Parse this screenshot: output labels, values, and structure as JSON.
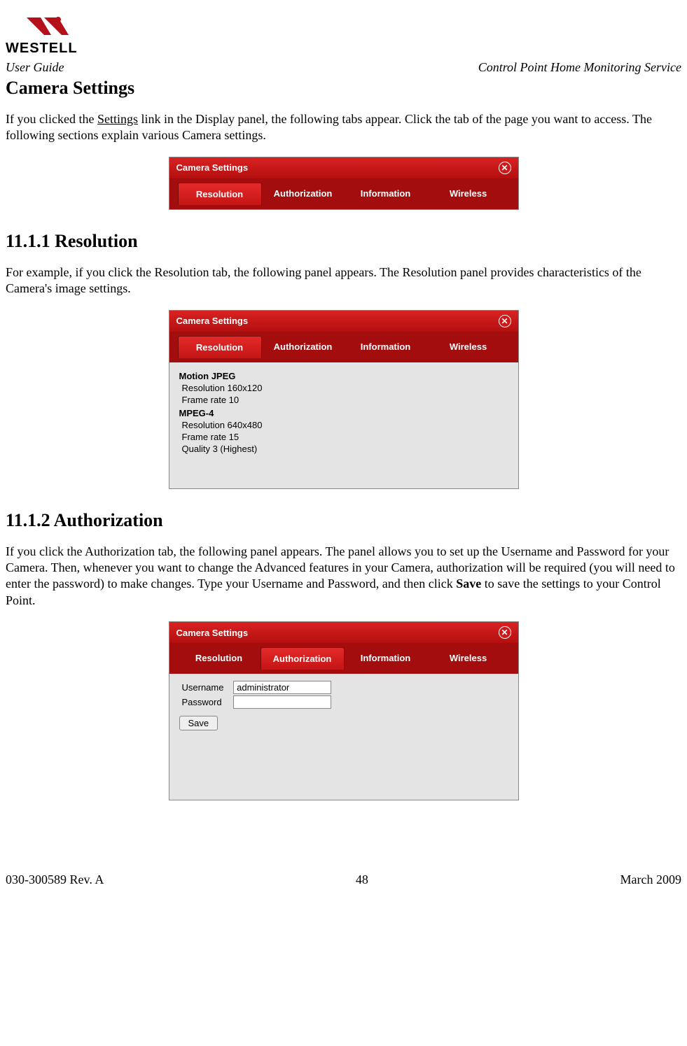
{
  "header": {
    "left": "User Guide",
    "right": "Control Point Home Monitoring Service"
  },
  "brand": "WESTELL",
  "section_title": "Camera Settings",
  "intro_before_link": "If you clicked the ",
  "intro_link": "Settings",
  "intro_after_link": " link in the Display panel, the following tabs appear. Click the tab of the page you want to access. The following sections explain various Camera settings.",
  "panel1": {
    "title": "Camera Settings",
    "tabs": [
      "Resolution",
      "Authorization",
      "Information",
      "Wireless"
    ],
    "active_tab": 0
  },
  "sub1": {
    "heading": "11.1.1 Resolution",
    "text": "For example, if you click the Resolution tab, the following panel appears. The Resolution panel provides characteristics of the Camera's image settings."
  },
  "panel2": {
    "title": "Camera Settings",
    "tabs": [
      "Resolution",
      "Authorization",
      "Information",
      "Wireless"
    ],
    "active_tab": 0,
    "body": {
      "group1_title": "Motion JPEG",
      "g1_row1": "Resolution  160x120",
      "g1_row2": "Frame rate 10",
      "group2_title": "MPEG-4",
      "g2_row1": "Resolution  640x480",
      "g2_row2": "Frame rate 15",
      "g2_row3": "Quality        3 (Highest)"
    }
  },
  "sub2": {
    "heading": "11.1.2 Authorization",
    "text_before_bold": "If you click the Authorization tab, the following panel appears. The panel allows you to set up the Username and Password for your Camera. Then, whenever you want to change the Advanced features in your Camera, authorization will be required (you will need to enter the password) to make changes. Type your Username and Password, and then click ",
    "bold_word": "Save",
    "text_after_bold": " to save the settings to your Control Point."
  },
  "panel3": {
    "title": "Camera Settings",
    "tabs": [
      "Resolution",
      "Authorization",
      "Information",
      "Wireless"
    ],
    "active_tab": 1,
    "body": {
      "username_label": "Username",
      "username_value": "administrator",
      "password_label": "Password",
      "save_label": "Save"
    }
  },
  "footer": {
    "left": "030-300589 Rev. A",
    "center": "48",
    "right": "March 2009"
  }
}
